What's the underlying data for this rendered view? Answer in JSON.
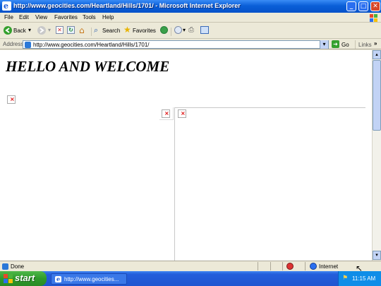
{
  "window": {
    "title": "http://www.geocities.com/Heartland/Hills/1701/ - Microsoft Internet Explorer",
    "buttons": {
      "minimize": "_",
      "maximize": "□",
      "close": "✕"
    }
  },
  "menu": [
    "File",
    "Edit",
    "View",
    "Favorites",
    "Tools",
    "Help"
  ],
  "toolbar": {
    "back": "Back",
    "search": "Search",
    "favorites": "Favorites"
  },
  "address": {
    "label": "Address",
    "url": "http://www.geocities.com/Heartland/Hills/1701/",
    "go": "Go",
    "links": "Links"
  },
  "page": {
    "heading": "HELLO AND WELCOME",
    "broken_image_glyph": "×"
  },
  "status": {
    "text": "Done",
    "zone": "Internet"
  },
  "taskbar": {
    "start": "start",
    "task": "http://www.geocities...",
    "clock": "11:15 AM"
  },
  "colors": {
    "titlebar": "#0a5fd8",
    "taskbar": "#245edb",
    "start": "#2e9a2a",
    "chrome": "#ece9d8"
  }
}
